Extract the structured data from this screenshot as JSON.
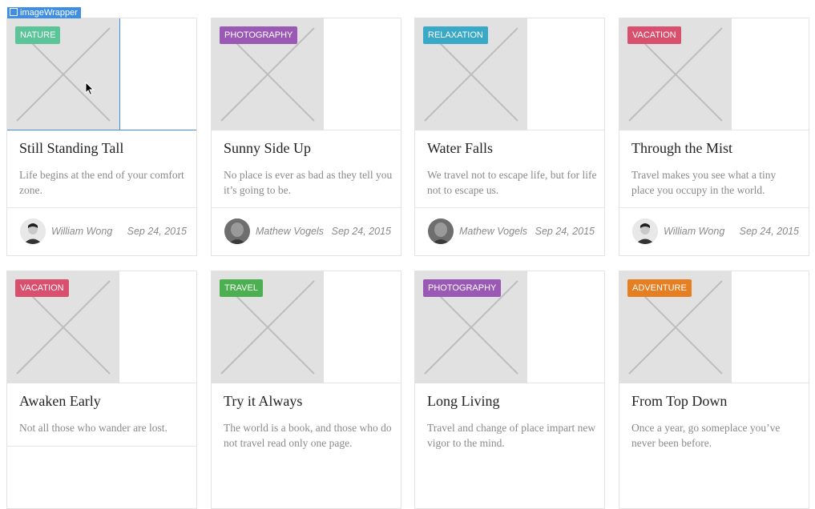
{
  "inspector": {
    "element_label": "imageWrapper"
  },
  "colors": {
    "nature": "#5bc599",
    "photography": "#9b59b6",
    "relaxation": "#3aa9c7",
    "vacation": "#d9506f",
    "travel": "#4caf50",
    "adventure": "#e67e22",
    "selection": "#3f8ee6"
  },
  "cards": [
    {
      "category": "NATURE",
      "title": "Still Standing Tall",
      "excerpt": "Life begins at the end of your comfort zone.",
      "author": "William Wong",
      "date": "Sep 24, 2015",
      "icon": "image-placeholder-icon"
    },
    {
      "category": "PHOTOGRAPHY",
      "title": "Sunny Side Up",
      "excerpt": "No place is ever as bad as they tell you it’s going to be.",
      "author": "Mathew Vogels",
      "date": "Sep 24, 2015",
      "icon": "image-placeholder-icon"
    },
    {
      "category": "RELAXATION",
      "title": "Water Falls",
      "excerpt": "We travel not to escape life, but for life not to escape us.",
      "author": "Mathew Vogels",
      "date": "Sep 24, 2015",
      "icon": "image-placeholder-icon"
    },
    {
      "category": "VACATION",
      "title": "Through the Mist",
      "excerpt": "Travel makes you see what a tiny place you occupy in the world.",
      "author": "William Wong",
      "date": "Sep 24, 2015",
      "icon": "image-placeholder-icon"
    },
    {
      "category": "VACATION",
      "title": "Awaken Early",
      "excerpt": "Not all those who wander are lost.",
      "author": "",
      "date": "",
      "icon": "image-placeholder-icon"
    },
    {
      "category": "TRAVEL",
      "title": "Try it Always",
      "excerpt": "The world is a book, and those who do not travel read only one page.",
      "author": "",
      "date": "",
      "icon": "image-placeholder-icon"
    },
    {
      "category": "PHOTOGRAPHY",
      "title": "Long Living",
      "excerpt": "Travel and change of place impart new vigor to the mind.",
      "author": "",
      "date": "",
      "icon": "image-placeholder-icon"
    },
    {
      "category": "ADVENTURE",
      "title": "From Top Down",
      "excerpt": "Once a year, go someplace you’ve never been before.",
      "author": "",
      "date": "",
      "icon": "image-placeholder-icon"
    }
  ]
}
